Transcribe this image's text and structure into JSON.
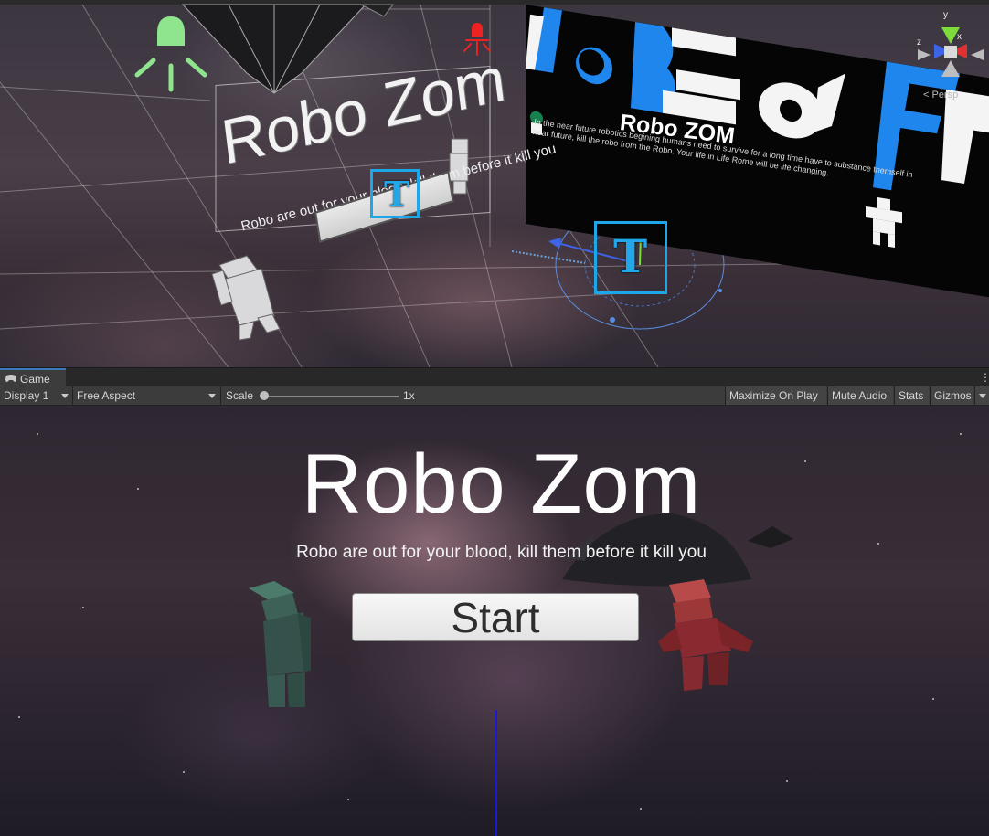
{
  "scene": {
    "title": "Robo Zom",
    "subtitle": "Robo are out for your blood, kill them before it kill you",
    "poster": {
      "title": "Robo ZOM",
      "description": "In the near future robotics begining humans need to survive for a long time have to substance themself in near future, kill the robo from the Robo. Your life in Life Rome will be life changing."
    },
    "gizmo": {
      "x_label": "x",
      "y_label": "y",
      "z_label": "z",
      "persp_label": "< Persp"
    },
    "colors": {
      "light_icon": "#8ee58e",
      "light_red": "#ee2222",
      "selection": "#1ea7e8"
    }
  },
  "game_tab": {
    "label": "Game",
    "icon": "gamepad-icon",
    "menu_icon": "kebab-menu-icon"
  },
  "toolbar": {
    "display": "Display 1",
    "aspect": "Free Aspect",
    "scale_label": "Scale",
    "scale_value": "1x",
    "scale_fraction": 0.0,
    "maximize_label": "Maximize On Play",
    "mute_label": "Mute Audio",
    "stats_label": "Stats",
    "gizmos_label": "Gizmos"
  },
  "game": {
    "title": "Robo Zom",
    "subtitle": "Robo are out for your blood, kill them before it kill you",
    "start_label": "Start",
    "colors": {
      "zombie_green": "#3d6156",
      "zombie_red": "#8a2a30",
      "blue_line": "#1919d8"
    }
  }
}
